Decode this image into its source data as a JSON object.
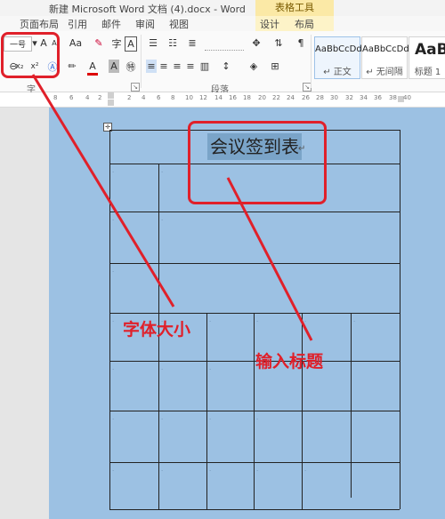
{
  "window": {
    "title": "新建 Microsoft Word 文档 (4).docx - Word"
  },
  "table_tools_tab": "表格工具",
  "tabs": [
    "页面布局",
    "引用",
    "邮件",
    "审阅",
    "视图",
    "设计",
    "布局"
  ],
  "ribbon": {
    "font_group_label": "字",
    "paragraph_group_label": "段落",
    "styles": [
      {
        "sample": "AaBbCcDd",
        "name": "↵ 正文"
      },
      {
        "sample": "AaBbCcDd",
        "name": "↵ 无间隔"
      },
      {
        "sample": "AaBl",
        "name": "标题 1"
      }
    ],
    "font_size_value": "一号",
    "grow_font": "A",
    "shrink_font": "A",
    "change_case": "Aa",
    "char_border": "A",
    "subscript": "x₂",
    "superscript": "x²",
    "font_color": "A",
    "phonetic": "字"
  },
  "ruler": {
    "ticks": [
      "8",
      "6",
      "4",
      "2",
      "2",
      "4",
      "6",
      "8",
      "10",
      "12",
      "14",
      "16",
      "18",
      "20",
      "22",
      "24",
      "26",
      "28",
      "30",
      "32",
      "34",
      "36",
      "38",
      "40"
    ]
  },
  "document": {
    "title": "会议签到表",
    "para_mark": "↵"
  },
  "annotations": {
    "font_size_label": "字体大小",
    "title_label": "输入标题"
  },
  "colors": {
    "annotation": "#e0202a",
    "selection": "#9cc1e3"
  }
}
